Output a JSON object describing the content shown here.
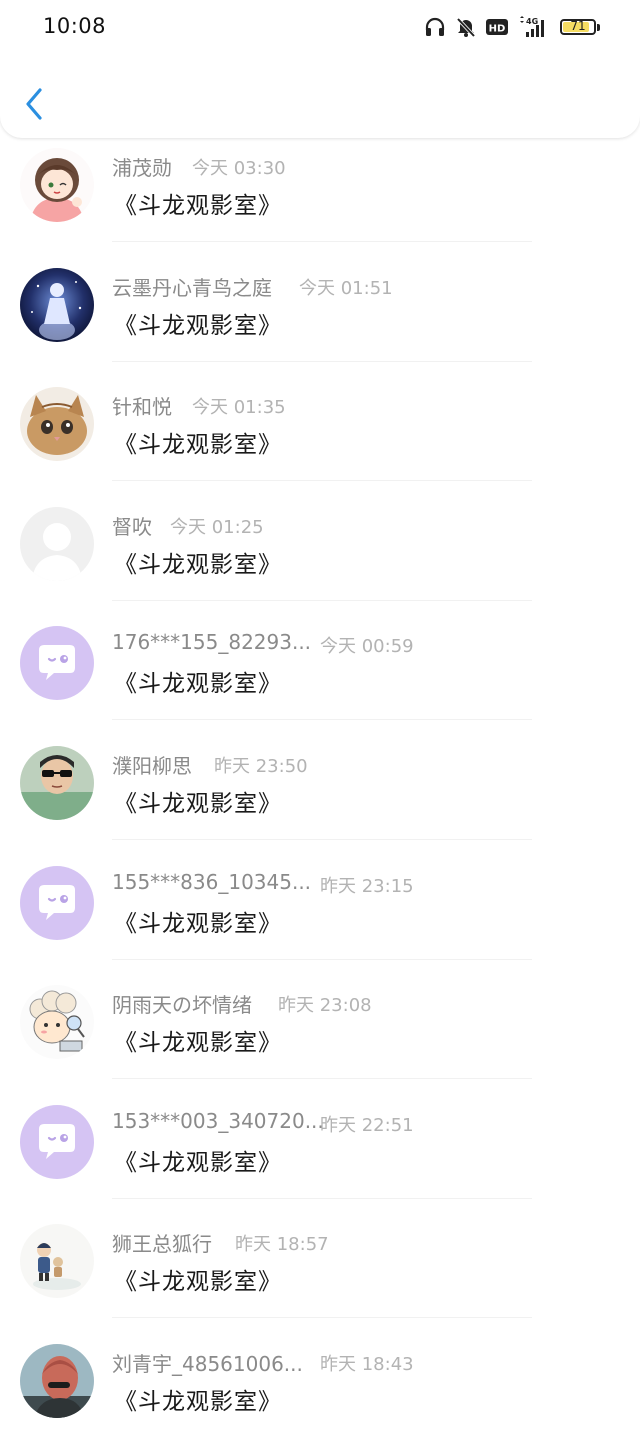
{
  "status_bar": {
    "time": "10:08",
    "icons": [
      "headphones-icon",
      "mute-bell-icon",
      "hd-icon",
      "signal-4g-icon"
    ],
    "battery": "71",
    "battery_color": "#f6dd63"
  },
  "header": {
    "back_icon": "chevron-left-icon",
    "accent_color": "#2b8fe0"
  },
  "messages": [
    {
      "name": "浦茂勋",
      "time": "今天 03:30",
      "text": "《斗龙观影室》",
      "avatar": "anime-girl"
    },
    {
      "name": "云墨丹心青鸟之庭",
      "time": "今天 01:51",
      "text": "《斗龙观影室》",
      "avatar": "anime-blue"
    },
    {
      "name": "针和悦",
      "time": "今天 01:35",
      "text": "《斗龙观影室》",
      "avatar": "kitten"
    },
    {
      "name": "督吹",
      "time": "今天 01:25",
      "text": "《斗龙观影室》",
      "avatar": "default-user"
    },
    {
      "name": "176***155_82293...",
      "time": "今天 00:59",
      "text": "《斗龙观影室》",
      "avatar": "chat-bubble"
    },
    {
      "name": "濮阳柳思",
      "time": "昨天 23:50",
      "text": "《斗龙观影室》",
      "avatar": "sunglasses"
    },
    {
      "name": "155***836_10345...",
      "time": "昨天 23:15",
      "text": "《斗龙观影室》",
      "avatar": "chat-bubble"
    },
    {
      "name": "阴雨天の坏情绪",
      "time": "昨天 23:08",
      "text": "《斗龙观影室》",
      "avatar": "cartoon-sheep"
    },
    {
      "name": "153***003_340720...",
      "time": "昨天 22:51",
      "text": "《斗龙观影室》",
      "avatar": "chat-bubble"
    },
    {
      "name": "狮王总狐行",
      "time": "昨天 18:57",
      "text": "《斗龙观影室》",
      "avatar": "tiny-figure"
    },
    {
      "name": "刘青宇_48561006...",
      "time": "昨天 18:43",
      "text": "《斗龙观影室》",
      "avatar": "person-red"
    }
  ]
}
